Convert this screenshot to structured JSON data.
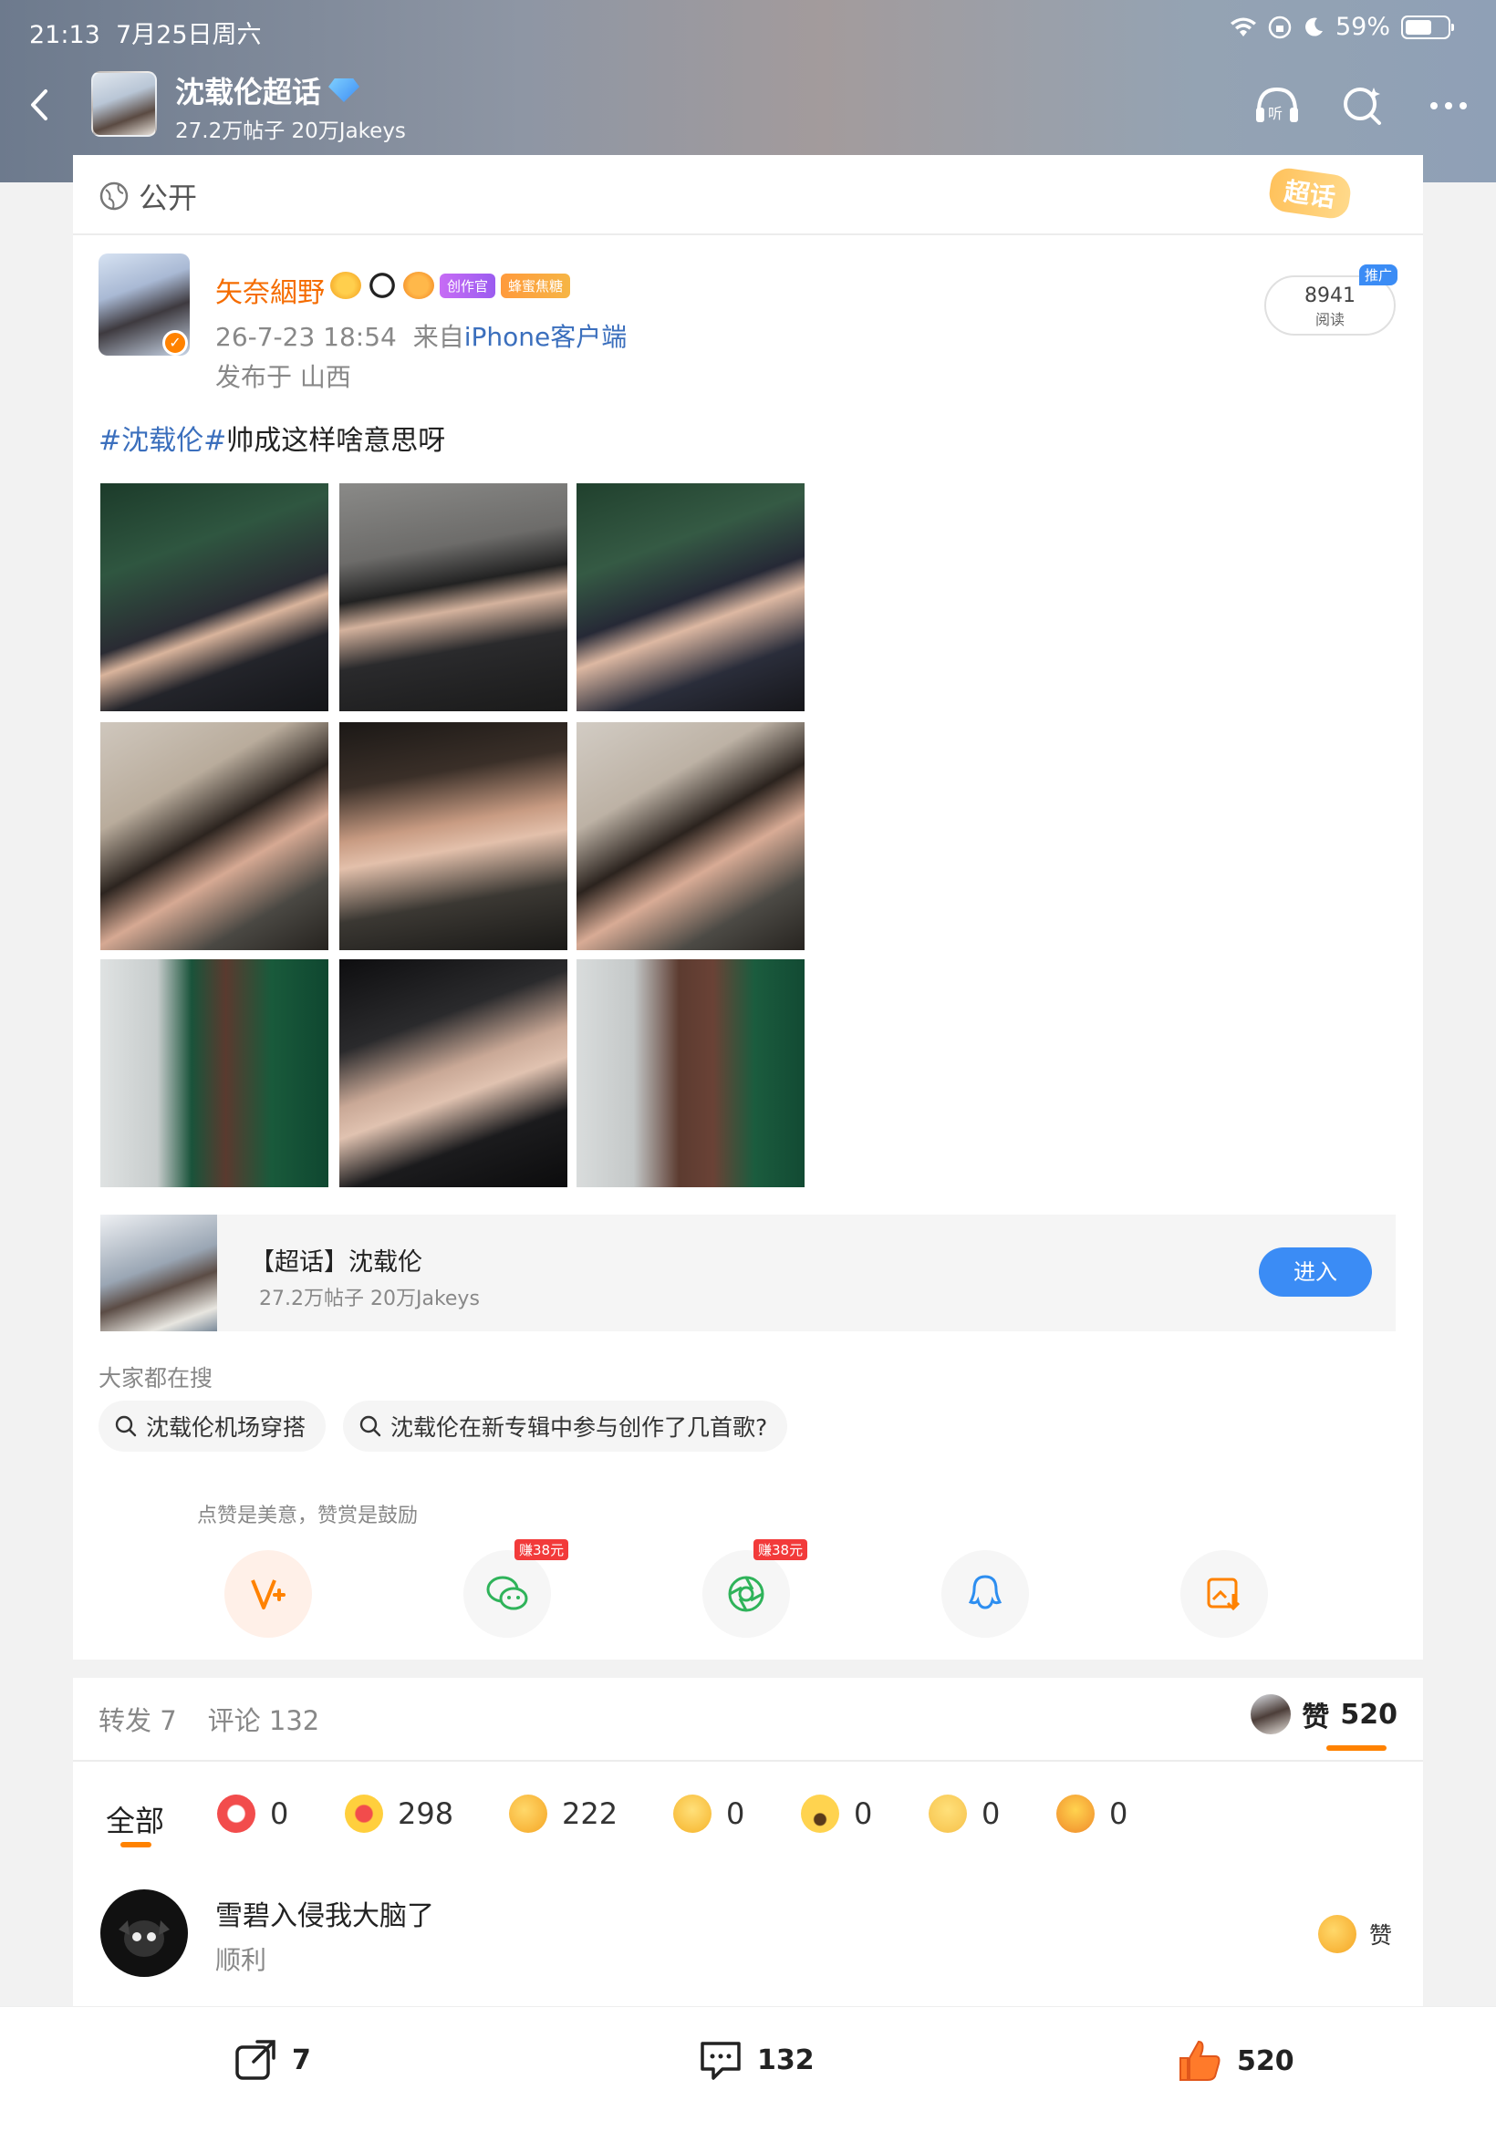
{
  "status": {
    "time": "21:13",
    "date": "7月25日周六",
    "battery": "59%"
  },
  "nav": {
    "title": "沈载伦超话",
    "subtitle": "27.2万帖子 20万Jakeys"
  },
  "post": {
    "visibility": "公开",
    "super_badge": "超话",
    "author": "矢奈絪野",
    "badge_creator": "创作官",
    "badge_fans": "蜂蜜焦糖",
    "time": "26-7-23 18:54",
    "from_prefix": "来自",
    "source": "iPhone客户端",
    "location": "发布于 山西",
    "read_count": "8941",
    "read_label": "阅读",
    "promo": "推广",
    "topic": "#沈载伦#",
    "text": "帅成这样啥意思呀"
  },
  "super_card": {
    "title": "【超话】沈载伦",
    "subtitle": "27.2万帖子 20万Jakeys",
    "button": "进入"
  },
  "search": {
    "title": "大家都在搜",
    "chips": [
      "沈载伦机场穿搭",
      "沈载伦在新专辑中参与创作了几首歌?"
    ]
  },
  "share": {
    "hint": "点赞是美意，赞赏是鼓励",
    "earn_label": "赚38元"
  },
  "stats": {
    "repost": "转发 7",
    "comment": "评论 132",
    "like_label": "赞",
    "like_count": "520"
  },
  "reactions": {
    "all": "全部",
    "items": [
      {
        "icon": "reward-icon",
        "count": "0"
      },
      {
        "icon": "heart-icon",
        "count": "298"
      },
      {
        "icon": "thumbs-up-icon",
        "count": "222"
      },
      {
        "icon": "laugh-icon",
        "count": "0"
      },
      {
        "icon": "surprised-icon",
        "count": "0"
      },
      {
        "icon": "sad-icon",
        "count": "0"
      },
      {
        "icon": "angry-icon",
        "count": "0"
      }
    ]
  },
  "comment": {
    "name": "雪碧入侵我大脑了",
    "text": "顺利",
    "like_label": "赞"
  },
  "bottom": {
    "repost": "7",
    "comment": "132",
    "like": "520"
  },
  "colors": {
    "accent": "#ff8200",
    "link": "#3b6fbd",
    "button": "#3b8cf5"
  }
}
